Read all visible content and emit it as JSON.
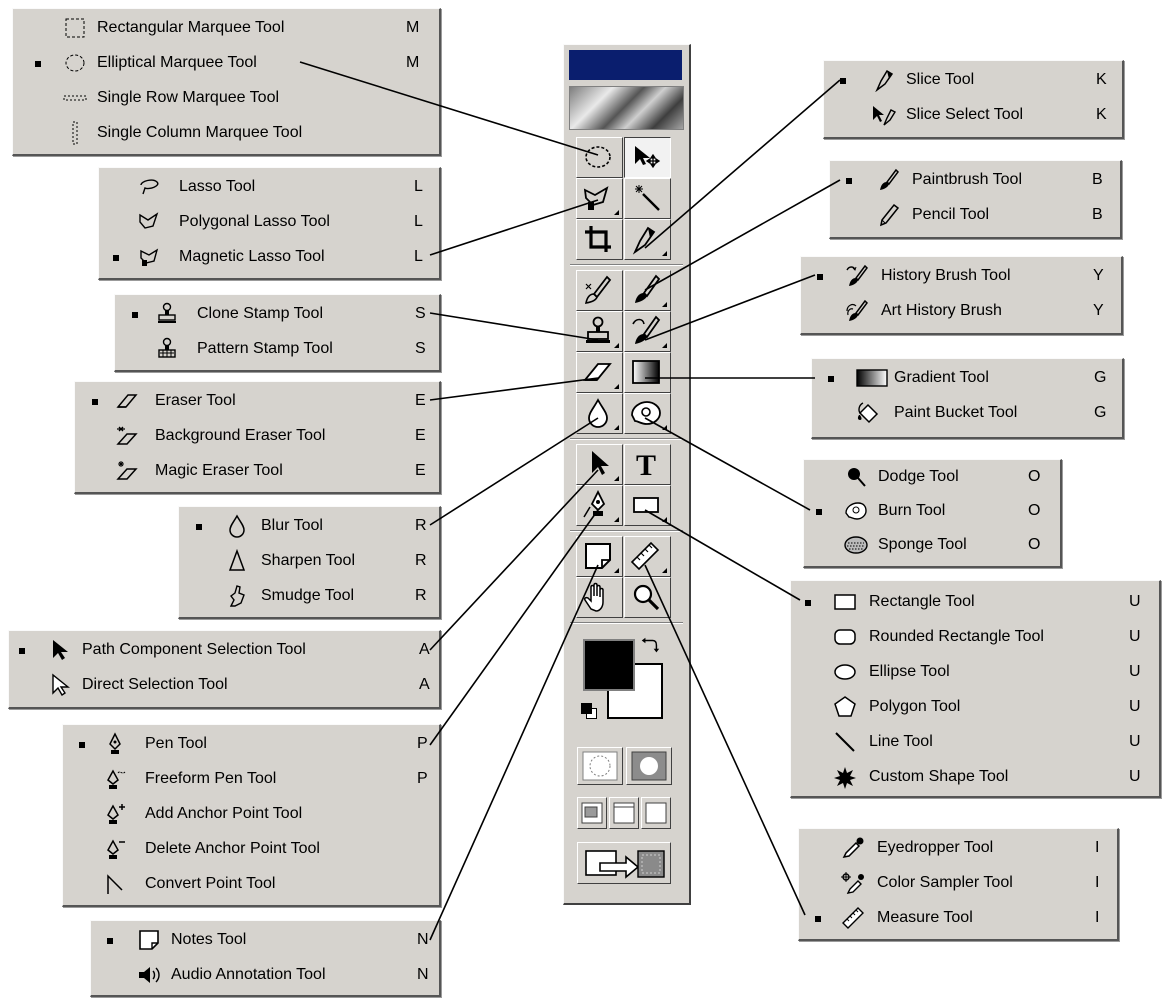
{
  "flyouts": {
    "marquee": [
      {
        "label": "Rectangular Marquee Tool",
        "key": "M"
      },
      {
        "label": "Elliptical Marquee Tool",
        "key": "M"
      },
      {
        "label": "Single Row Marquee Tool",
        "key": ""
      },
      {
        "label": "Single Column Marquee Tool",
        "key": ""
      }
    ],
    "lasso": [
      {
        "label": "Lasso Tool",
        "key": "L"
      },
      {
        "label": "Polygonal Lasso Tool",
        "key": "L"
      },
      {
        "label": "Magnetic Lasso Tool",
        "key": "L"
      }
    ],
    "stamp": [
      {
        "label": "Clone Stamp Tool",
        "key": "S"
      },
      {
        "label": "Pattern Stamp Tool",
        "key": "S"
      }
    ],
    "eraser": [
      {
        "label": "Eraser Tool",
        "key": "E"
      },
      {
        "label": "Background Eraser Tool",
        "key": "E"
      },
      {
        "label": "Magic Eraser Tool",
        "key": "E"
      }
    ],
    "blur": [
      {
        "label": "Blur Tool",
        "key": "R"
      },
      {
        "label": "Sharpen Tool",
        "key": "R"
      },
      {
        "label": "Smudge Tool",
        "key": "R"
      }
    ],
    "path_select": [
      {
        "label": "Path Component Selection Tool",
        "key": "A"
      },
      {
        "label": "Direct Selection Tool",
        "key": "A"
      }
    ],
    "pen": [
      {
        "label": "Pen Tool",
        "key": "P"
      },
      {
        "label": "Freeform Pen Tool",
        "key": "P"
      },
      {
        "label": "Add Anchor Point Tool",
        "key": ""
      },
      {
        "label": "Delete Anchor Point Tool",
        "key": ""
      },
      {
        "label": "Convert Point Tool",
        "key": ""
      }
    ],
    "notes": [
      {
        "label": "Notes Tool",
        "key": "N"
      },
      {
        "label": "Audio Annotation Tool",
        "key": "N"
      }
    ],
    "slice": [
      {
        "label": "Slice Tool",
        "key": "K"
      },
      {
        "label": "Slice Select Tool",
        "key": "K"
      }
    ],
    "paint": [
      {
        "label": "Paintbrush Tool",
        "key": "B"
      },
      {
        "label": "Pencil Tool",
        "key": "B"
      }
    ],
    "history": [
      {
        "label": "History Brush Tool",
        "key": "Y"
      },
      {
        "label": "Art History Brush",
        "key": "Y"
      }
    ],
    "gradient": [
      {
        "label": "Gradient Tool",
        "key": "G"
      },
      {
        "label": "Paint Bucket Tool",
        "key": "G"
      }
    ],
    "dodge": [
      {
        "label": "Dodge Tool",
        "key": "O"
      },
      {
        "label": "Burn Tool",
        "key": "O"
      },
      {
        "label": "Sponge Tool",
        "key": "O"
      }
    ],
    "shape": [
      {
        "label": "Rectangle Tool",
        "key": "U"
      },
      {
        "label": "Rounded Rectangle Tool",
        "key": "U"
      },
      {
        "label": "Ellipse Tool",
        "key": "U"
      },
      {
        "label": "Polygon Tool",
        "key": "U"
      },
      {
        "label": "Line Tool",
        "key": "U"
      },
      {
        "label": "Custom Shape Tool",
        "key": "U"
      }
    ],
    "eyedropper": [
      {
        "label": "Eyedropper Tool",
        "key": "I"
      },
      {
        "label": "Color Sampler Tool",
        "key": "I"
      },
      {
        "label": "Measure Tool",
        "key": "I"
      }
    ]
  },
  "toolbox": {
    "type_tool_glyph": "T",
    "colors": {
      "foreground": "#000000",
      "background": "#ffffff",
      "titlebar": "#0a1e6e",
      "panel": "#d6d3ce"
    }
  }
}
